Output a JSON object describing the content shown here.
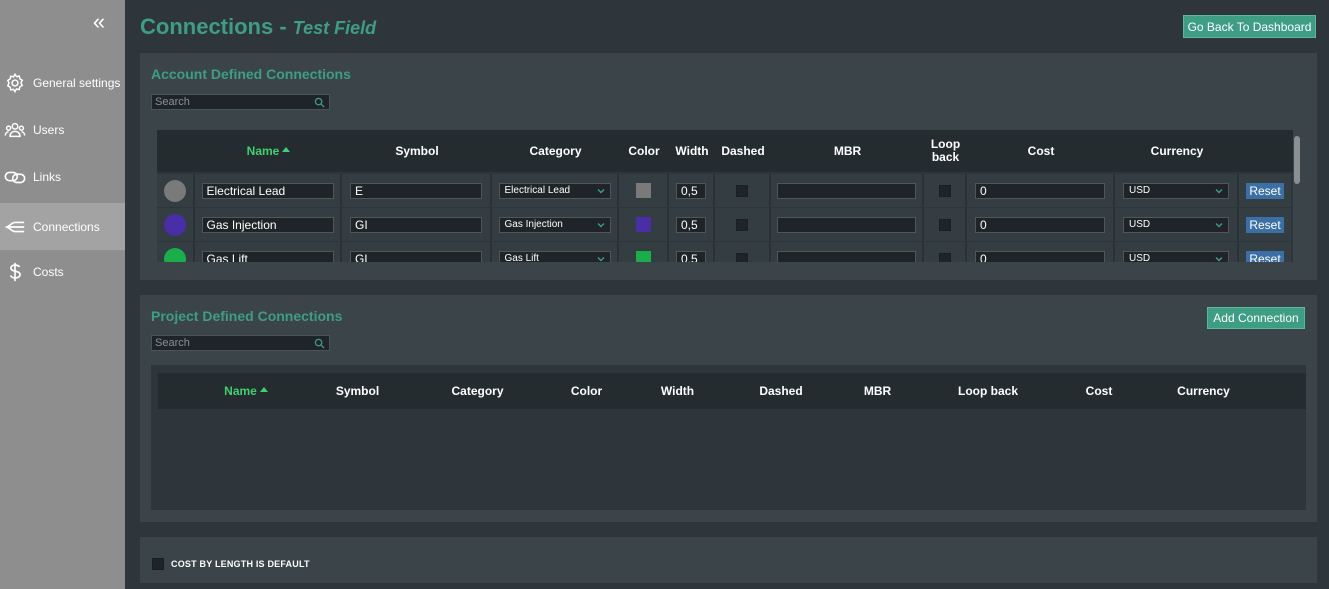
{
  "sidebar": {
    "collapse_icon": "double-chevron-left-icon",
    "items": [
      {
        "label": "General settings",
        "icon": "gear-icon",
        "active": false
      },
      {
        "label": "Users",
        "icon": "users-icon",
        "active": false
      },
      {
        "label": "Links",
        "icon": "link-icon",
        "active": false
      },
      {
        "label": "Connections",
        "icon": "connections-icon",
        "active": true
      },
      {
        "label": "Costs",
        "icon": "dollar-icon",
        "active": false
      }
    ]
  },
  "header": {
    "title": "Connections -",
    "subtitle": "Test Field",
    "back_button": "Go Back To Dashboard"
  },
  "account_section": {
    "title": "Account Defined Connections",
    "search_placeholder": "Search",
    "columns": [
      "Name",
      "Symbol",
      "Category",
      "Color",
      "Width",
      "Dashed",
      "MBR",
      "Loop back",
      "Cost",
      "Currency"
    ],
    "rows": [
      {
        "dot_color": "#7a7a7a",
        "name": "Electrical Lead",
        "symbol": "E",
        "category": "Electrical Lead",
        "color": "#7a7a7a",
        "width": "0,5",
        "dashed": false,
        "mbr": "",
        "loop_back": false,
        "cost": "0",
        "currency": "USD",
        "reset": "Reset"
      },
      {
        "dot_color": "#4a2ea8",
        "name": "Gas Injection",
        "symbol": "GI",
        "category": "Gas Injection",
        "color": "#4a2ea8",
        "width": "0,5",
        "dashed": false,
        "mbr": "",
        "loop_back": false,
        "cost": "0",
        "currency": "USD",
        "reset": "Reset"
      },
      {
        "dot_color": "#1aae4a",
        "name": "Gas Lift",
        "symbol": "GL",
        "category": "Gas Lift",
        "color": "#1aae4a",
        "width": "0,5",
        "dashed": false,
        "mbr": "",
        "loop_back": false,
        "cost": "0",
        "currency": "USD",
        "reset": "Reset"
      }
    ]
  },
  "project_section": {
    "title": "Project Defined Connections",
    "add_button": "Add Connection",
    "search_placeholder": "Search",
    "columns": [
      "Name",
      "Symbol",
      "Category",
      "Color",
      "Width",
      "Dashed",
      "MBR",
      "Loop back",
      "Cost",
      "Currency"
    ]
  },
  "footer": {
    "checkbox_label": "COST BY LENGTH IS DEFAULT",
    "checked": false
  }
}
